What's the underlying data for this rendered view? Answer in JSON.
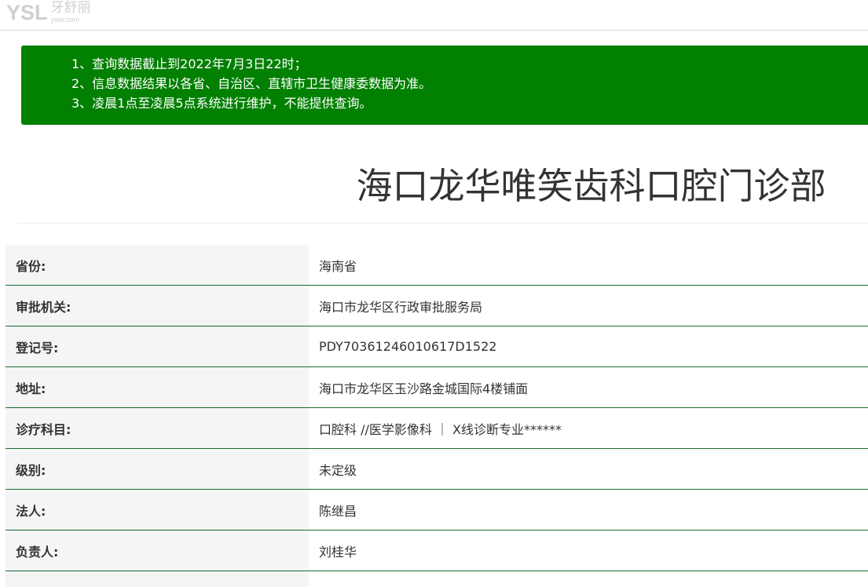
{
  "header": {
    "logo_mark": "YSL",
    "logo_cn": "牙舒丽",
    "logo_url": "yslw.com"
  },
  "notice": {
    "lines": [
      "1、查询数据截止到2022年7月3日22时；",
      "2、信息数据结果以各省、自治区、直辖市卫生健康委数据为准。",
      "3、凌晨1点至凌晨5点系统进行维护，不能提供查询。"
    ]
  },
  "clinic": {
    "name": "海口龙华唯笑齿科口腔门诊部"
  },
  "fields": [
    {
      "label": "省份:",
      "value": "海南省"
    },
    {
      "label": "审批机关:",
      "value": "海口市龙华区行政审批服务局"
    },
    {
      "label": "登记号:",
      "value": "PDY70361246010617D1522"
    },
    {
      "label": "地址:",
      "value": "海口市龙华区玉沙路金城国际4楼铺面"
    },
    {
      "label": "诊疗科目:",
      "value": "口腔科 //医学影像科 ｜ X线诊断专业******"
    },
    {
      "label": "级别:",
      "value": "未定级"
    },
    {
      "label": "法人:",
      "value": "陈继昌"
    },
    {
      "label": "负责人:",
      "value": "刘桂华"
    }
  ],
  "colors": {
    "notice_bg": "#028002",
    "row_border": "#1a6b2e",
    "label_bg": "#f5f5f5"
  }
}
